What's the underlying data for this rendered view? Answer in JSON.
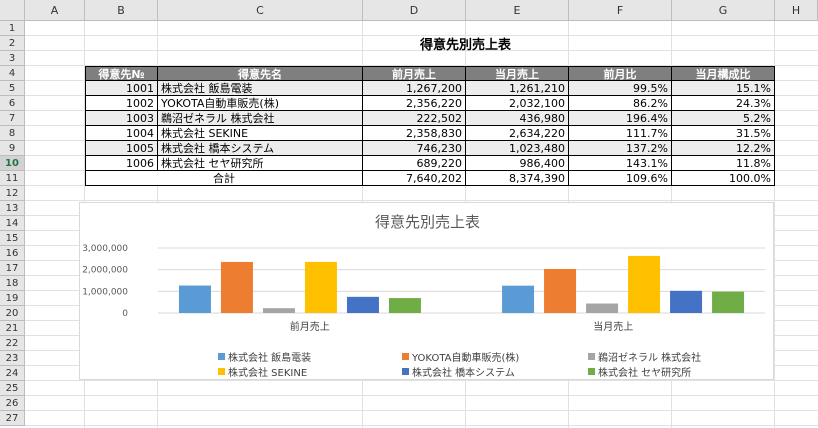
{
  "columns": [
    "A",
    "B",
    "C",
    "D",
    "E",
    "F",
    "G",
    "H"
  ],
  "rows": [
    "1",
    "2",
    "3",
    "4",
    "5",
    "6",
    "7",
    "8",
    "9",
    "10",
    "11",
    "12",
    "13",
    "14",
    "15",
    "16",
    "17",
    "18",
    "19",
    "20",
    "21",
    "22",
    "23",
    "24",
    "25",
    "26",
    "27"
  ],
  "selected_row": "10",
  "table": {
    "title": "得意先別売上表",
    "headers": [
      "得意先№",
      "得意先名",
      "前月売上",
      "当月売上",
      "前月比",
      "当月構成比"
    ],
    "rows": [
      [
        "1001",
        "株式会社 飯島電装",
        "1,267,200",
        "1,261,210",
        "99.5%",
        "15.1%"
      ],
      [
        "1002",
        "YOKOTA自動車販売(株)",
        "2,356,220",
        "2,032,100",
        "86.2%",
        "24.3%"
      ],
      [
        "1003",
        "鵜沼ゼネラル 株式会社",
        "222,502",
        "436,980",
        "196.4%",
        "5.2%"
      ],
      [
        "1004",
        "株式会社 SEKINE",
        "2,358,830",
        "2,634,220",
        "111.7%",
        "31.5%"
      ],
      [
        "1005",
        "株式会社 橋本システム",
        "746,230",
        "1,023,480",
        "137.2%",
        "12.2%"
      ],
      [
        "1006",
        "株式会社 セヤ研究所",
        "689,220",
        "986,400",
        "143.1%",
        "11.8%"
      ]
    ],
    "total": {
      "label": "合計",
      "prev": "7,640,202",
      "curr": "8,374,390",
      "ratio": "109.6%",
      "share": "100.0%"
    }
  },
  "chart_data": {
    "type": "bar",
    "title": "得意先別売上表",
    "categories": [
      "前月売上",
      "当月売上"
    ],
    "ylim": [
      0,
      3000000
    ],
    "yticks": [
      "3,000,000",
      "2,000,000",
      "1,000,000",
      "0"
    ],
    "grid": true,
    "legend_position": "bottom",
    "series": [
      {
        "name": "株式会社 飯島電装",
        "color": "#5b9bd5",
        "values": [
          1267200,
          1261210
        ]
      },
      {
        "name": "YOKOTA自動車販売(株)",
        "color": "#ed7d31",
        "values": [
          2356220,
          2032100
        ]
      },
      {
        "name": "鵜沼ゼネラル 株式会社",
        "color": "#a5a5a5",
        "values": [
          222502,
          436980
        ]
      },
      {
        "name": "株式会社 SEKINE",
        "color": "#ffc000",
        "values": [
          2358830,
          2634220
        ]
      },
      {
        "name": "株式会社 橋本システム",
        "color": "#4472c4",
        "values": [
          746230,
          1023480
        ]
      },
      {
        "name": "株式会社 セヤ研究所",
        "color": "#70ad47",
        "values": [
          689220,
          986400
        ]
      }
    ]
  }
}
